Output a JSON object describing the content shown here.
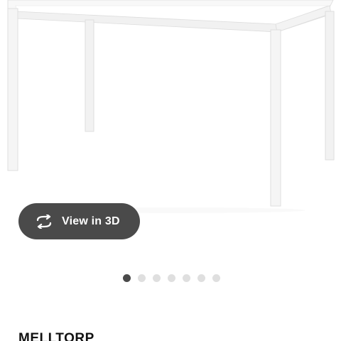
{
  "product": {
    "image_alt": "White dining table",
    "view_3d_label": "View in 3D",
    "view_3d_icon": "rotate-3d-icon",
    "name": "MELLTORP"
  },
  "carousel": {
    "total": 7,
    "active_index": 0
  },
  "colors": {
    "button_background": "#4a4a4a",
    "button_text": "#ffffff",
    "dot_active": "#4a4a4a",
    "dot_inactive": "#dfdfdf",
    "table_white": "#f7f7f7"
  }
}
